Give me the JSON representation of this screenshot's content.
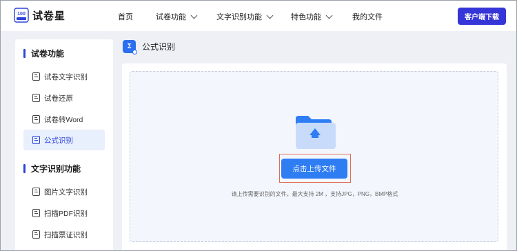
{
  "header": {
    "brand": "试卷星",
    "nav": [
      {
        "label": "首页",
        "has_dropdown": false
      },
      {
        "label": "试卷功能",
        "has_dropdown": true
      },
      {
        "label": "文字识别功能",
        "has_dropdown": true
      },
      {
        "label": "特色功能",
        "has_dropdown": true
      },
      {
        "label": "我的文件",
        "has_dropdown": false
      }
    ],
    "download_label": "客户端下载"
  },
  "sidebar": {
    "sections": [
      {
        "title": "试卷功能",
        "items": [
          {
            "label": "试卷文字识别",
            "active": false
          },
          {
            "label": "试卷还原",
            "active": false
          },
          {
            "label": "试卷转Word",
            "active": false
          },
          {
            "label": "公式识别",
            "active": true
          }
        ]
      },
      {
        "title": "文字识别功能",
        "items": [
          {
            "label": "图片文字识别",
            "active": false
          },
          {
            "label": "扫描PDF识别",
            "active": false
          },
          {
            "label": "扫描票证识别",
            "active": false
          }
        ]
      }
    ]
  },
  "main": {
    "title": "公式识别",
    "upload_button": "点击上传文件",
    "hint": "请上传需要识别的文件，最大支持 2M ，支持JPG，PNG，BMP格式"
  },
  "colors": {
    "accent": "#2c44d6",
    "download_button": "#3535d8",
    "upload_button": "#2f7df3",
    "highlight_border": "#e06b56"
  }
}
